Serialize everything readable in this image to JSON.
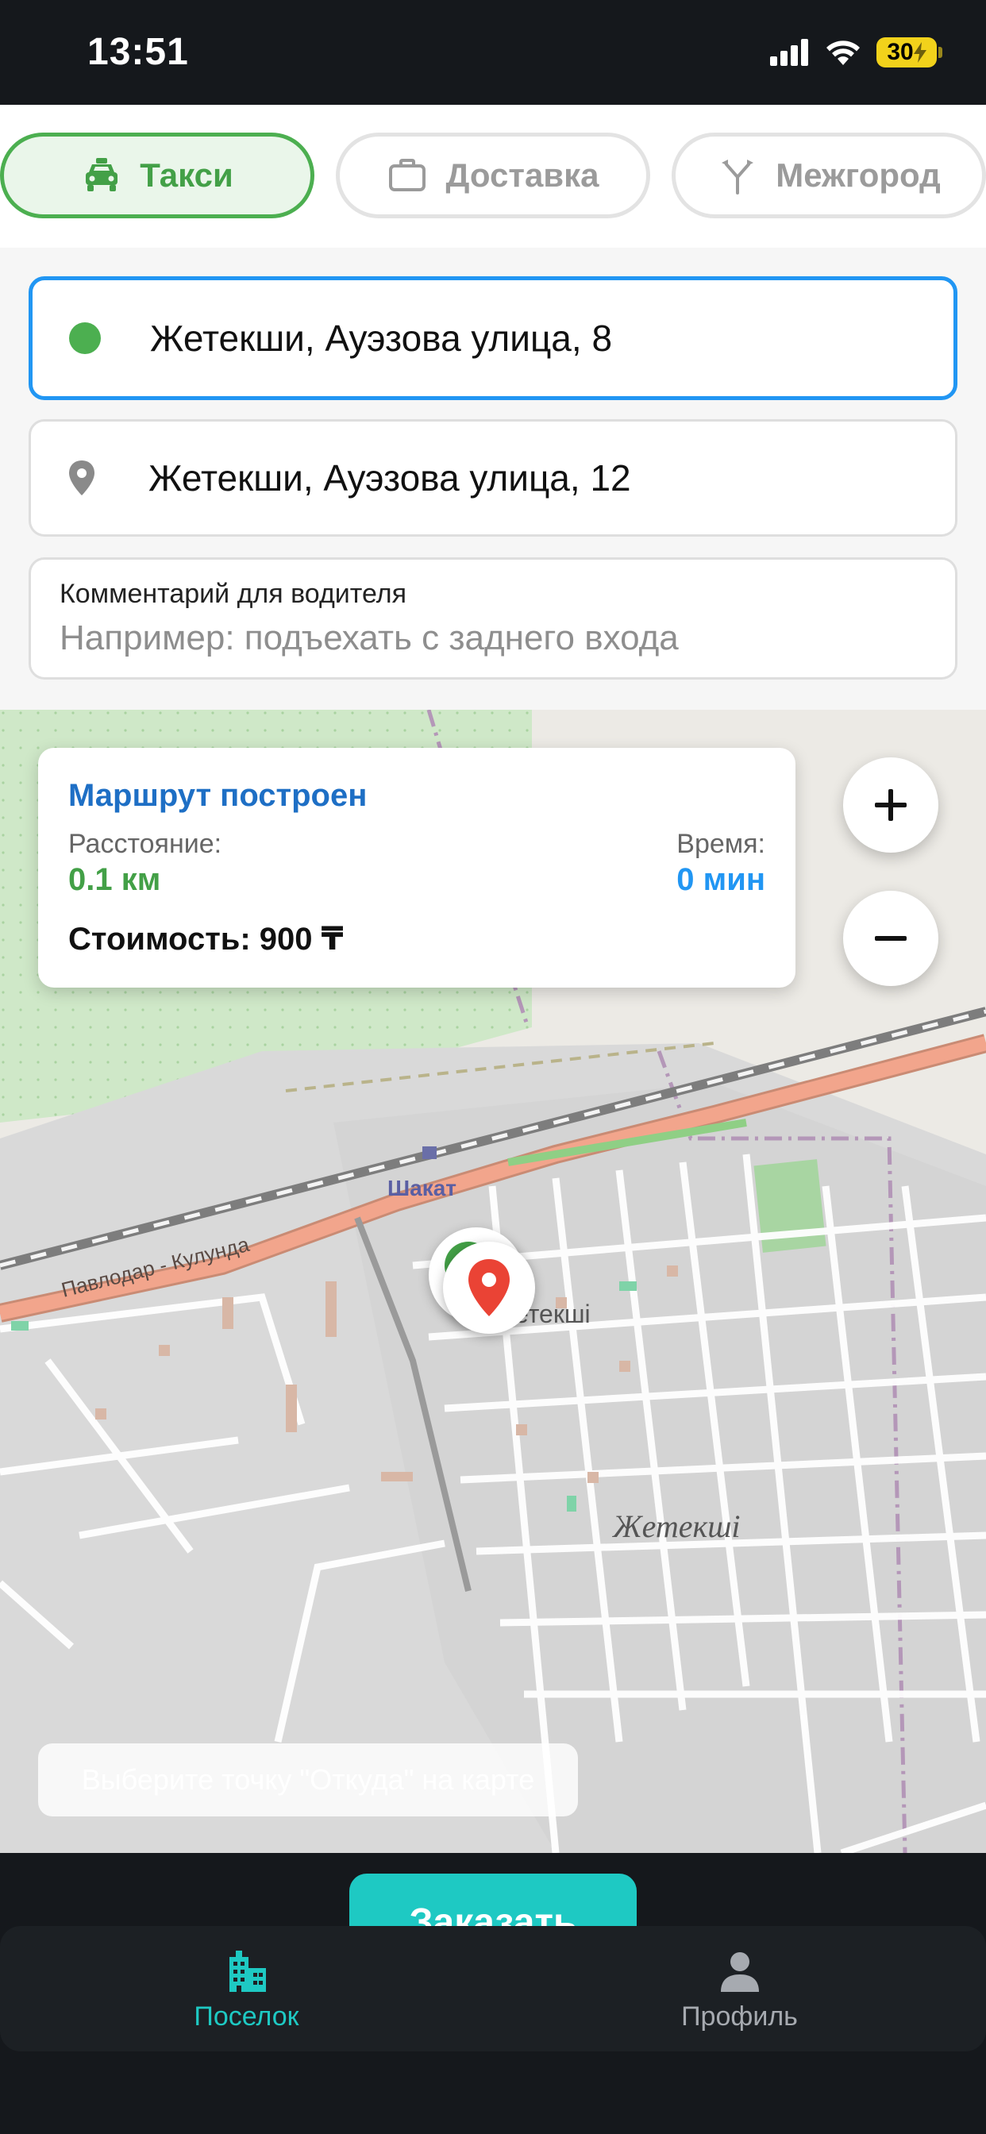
{
  "status_bar": {
    "time": "13:51",
    "battery": "30"
  },
  "tabs": [
    {
      "label": "Такси",
      "icon": "taxi-icon",
      "active": true
    },
    {
      "label": "Доставка",
      "icon": "briefcase-icon",
      "active": false
    },
    {
      "label": "Межгород",
      "icon": "route-split-icon",
      "active": false
    }
  ],
  "form": {
    "from": "Жетекши, Ауэзова улица, 8",
    "to": "Жетекши, Ауэзова улица, 12",
    "comment_label": "Комментарий для водителя",
    "comment_placeholder": "Например: подъехать с заднего входа",
    "comment_value": ""
  },
  "route_info": {
    "title": "Маршрут построен",
    "distance_label": "Расстояние:",
    "distance_value": "0.1 км",
    "time_label": "Время:",
    "time_value": "0 мин",
    "cost": "Стоимость: 900 ₸"
  },
  "map": {
    "labels": {
      "station": "Шакат",
      "road": "Павлодар - Кулунда",
      "village_short": "етекші",
      "village": "Жетекші"
    },
    "hint": "Выберите точку \"Откуда\" на карте",
    "zoom_in": "+",
    "zoom_out": "−"
  },
  "order_button": "Заказать",
  "nav": {
    "village": "Поселок",
    "profile": "Профиль"
  },
  "colors": {
    "accent": "#1ec9c3",
    "green": "#43a047",
    "blue": "#2196f3",
    "route_title": "#1e6fc5",
    "marker_red": "#ea4335"
  }
}
